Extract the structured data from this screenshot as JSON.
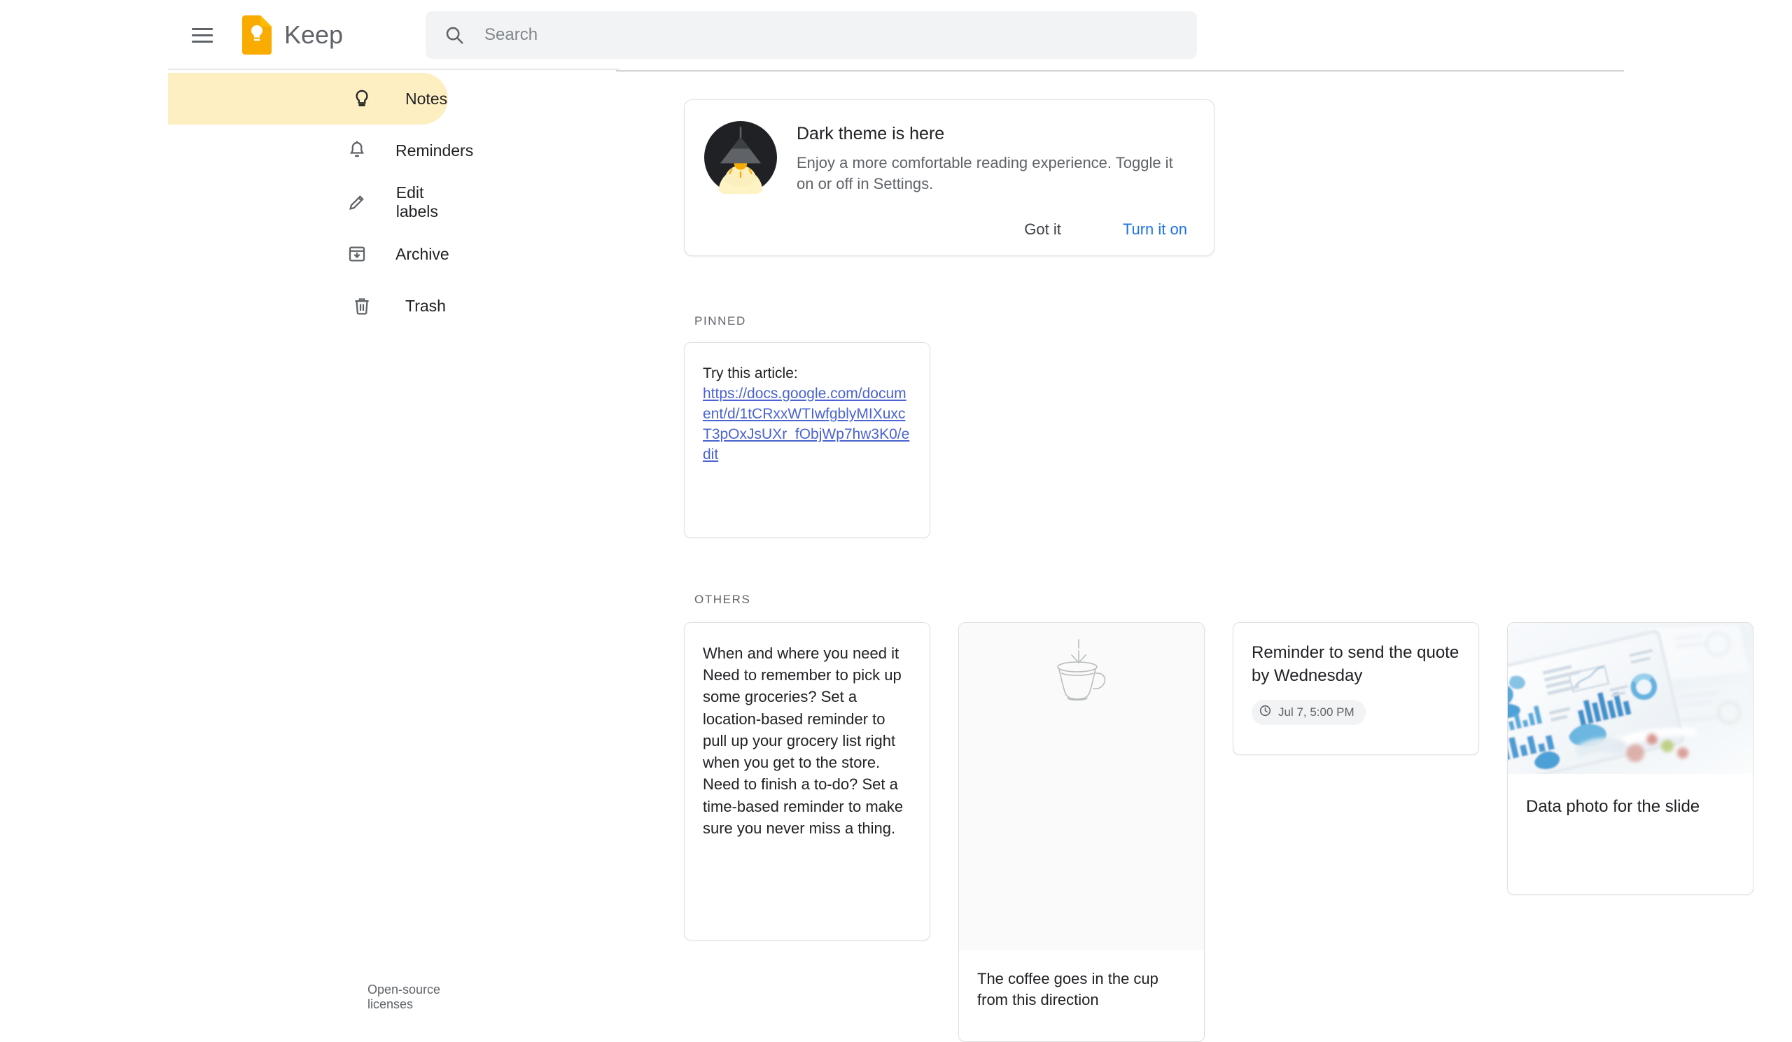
{
  "app": {
    "brand_name": "Keep",
    "logo_icon": "keep-note-bulb-icon",
    "menu_icon": "hamburger-menu-icon"
  },
  "search": {
    "placeholder": "Search",
    "value": "",
    "icon": "search-icon"
  },
  "sidebar": {
    "items": [
      {
        "label": "Notes",
        "icon": "lightbulb-icon",
        "active": true
      },
      {
        "label": "Reminders",
        "icon": "bell-icon",
        "active": false
      },
      {
        "label": "Edit labels",
        "icon": "pencil-icon",
        "active": false
      },
      {
        "label": "Archive",
        "icon": "archive-icon",
        "active": false
      },
      {
        "label": "Trash",
        "icon": "trash-icon",
        "active": false
      }
    ],
    "footer_link": "Open-source licenses"
  },
  "banner": {
    "illustration_icon": "dark-theme-lamp-illustration",
    "title": "Dark theme is here",
    "body": "Enjoy a more comfortable reading experience. Toggle it on or off in Settings.",
    "dismiss_label": "Got it",
    "action_label": "Turn it on",
    "action_color": "#1a73e8"
  },
  "sections": {
    "pinned_label": "PINNED",
    "others_label": "OTHERS"
  },
  "notes": {
    "pinned": [
      {
        "lead_text": "Try this article:",
        "link_text": "https://docs.google.com/document/d/1tCRxxWTIwfgblyMIXuxcT3pOxJsUXr_fObjWp7hw3K0/edit",
        "link_color": "#4a63d0"
      }
    ],
    "others": [
      {
        "body": "When and where you need it\nNeed to remember to pick up some groceries? Set a location-based reminder to pull up your grocery list right when you get to the store. Need to finish a to-do? Set a time-based reminder to make sure you never miss a thing."
      },
      {
        "sketch_icon": "coffee-cup-sketch-with-down-arrow",
        "body": "The coffee goes in the cup from this direction"
      },
      {
        "title": "Reminder to send the quote by Wednesday",
        "reminder_chip_icon": "clock-icon",
        "reminder_chip_label": "Jul 7, 5:00 PM"
      },
      {
        "image_icon": "tablet-data-charts-photo",
        "title": "Data photo for the slide"
      }
    ]
  }
}
